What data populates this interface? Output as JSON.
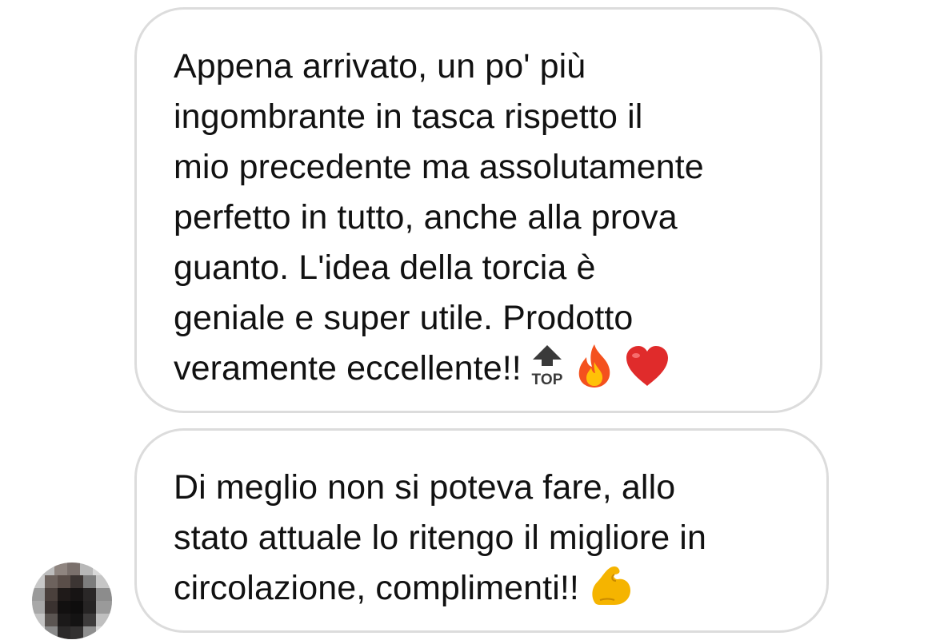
{
  "thread": {
    "messages": [
      {
        "text": "Appena arrivato, un po' più\ningombrante in tasca rispetto il\nmio precedente ma assolutamente\nperfetto in tutto, anche alla prova\nguanto. L'idea della torcia è\ngeniale e super utile. Prodotto\nveramente eccellente!!",
        "emojis": [
          "top-arrow-icon",
          "fire-icon",
          "red-heart-icon"
        ],
        "top_label": "TOP"
      },
      {
        "text": "Di meglio non si poteva fare, allo\nstato attuale lo ritengo il migliore in\ncircolazione, complimenti!!",
        "emojis": [
          "flexed-biceps-icon"
        ]
      }
    ],
    "sender_avatar": "pixelated-avatar"
  },
  "colors": {
    "bubble_border": "#dcdcdc",
    "text": "#111111",
    "heart": "#e02b2b",
    "fire_outer": "#f4511e",
    "fire_inner": "#ffc107",
    "biceps": "#f5b400"
  }
}
